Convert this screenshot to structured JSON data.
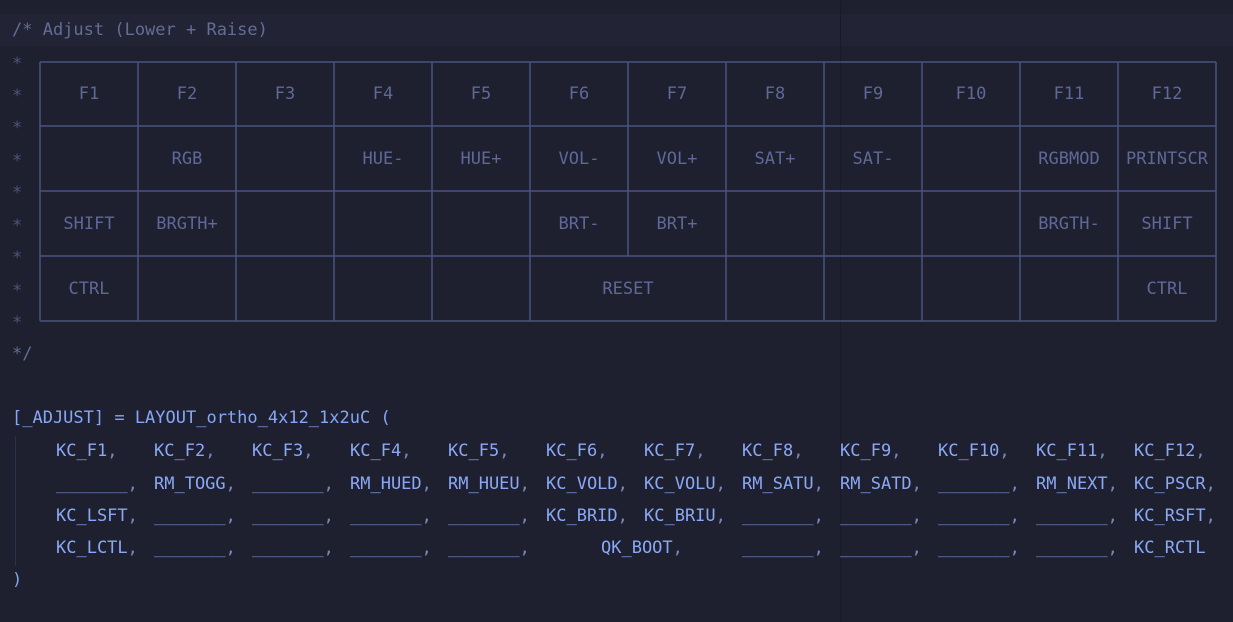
{
  "header_comment": "/* Adjust (Lower + Raise)",
  "footer_comment": "*/",
  "star": "*",
  "table": {
    "rows": [
      [
        "F1",
        "F2",
        "F3",
        "F4",
        "F5",
        "F6",
        "F7",
        "F8",
        "F9",
        "F10",
        "F11",
        "F12"
      ],
      [
        "",
        "RGB",
        "",
        "HUE-",
        "HUE+",
        "VOL-",
        "VOL+",
        "SAT+",
        "SAT-",
        "",
        "RGBMOD",
        "PRINTSCR"
      ],
      [
        "SHIFT",
        "BRGTH+",
        "",
        "",
        "",
        "BRT-",
        "BRT+",
        "",
        "",
        "",
        "BRGTH-",
        "SHIFT"
      ],
      [
        "CTRL",
        "",
        "",
        "",
        "",
        "RESET",
        "",
        "",
        "",
        "",
        "",
        "CTRL"
      ]
    ]
  },
  "code": {
    "declaration": "[_ADJUST] = LAYOUT_ortho_4x12_1x2uC (",
    "rows": [
      [
        "KC_F1,",
        "KC_F2,",
        "KC_F3,",
        "KC_F4,",
        "KC_F5,",
        "KC_F6,",
        "KC_F7,",
        "KC_F8,",
        "KC_F9,",
        "KC_F10,",
        "KC_F11,",
        "KC_F12,"
      ],
      [
        "_______,",
        "RM_TOGG,",
        "_______,",
        "RM_HUED,",
        "RM_HUEU,",
        "KC_VOLD,",
        "KC_VOLU,",
        "RM_SATU,",
        "RM_SATD,",
        "_______,",
        "RM_NEXT,",
        "KC_PSCR,"
      ],
      [
        "KC_LSFT,",
        "_______,",
        "_______,",
        "_______,",
        "_______,",
        "KC_BRID,",
        "KC_BRIU,",
        "_______,",
        "_______,",
        "_______,",
        "_______,",
        "KC_RSFT,"
      ],
      [
        "KC_LCTL,",
        "_______,",
        "_______,",
        "_______,",
        "_______,",
        "QK_BOOT,",
        "",
        "_______,",
        "_______,",
        "_______,",
        "_______,",
        "KC_RCTL"
      ]
    ],
    "closing": ")"
  }
}
